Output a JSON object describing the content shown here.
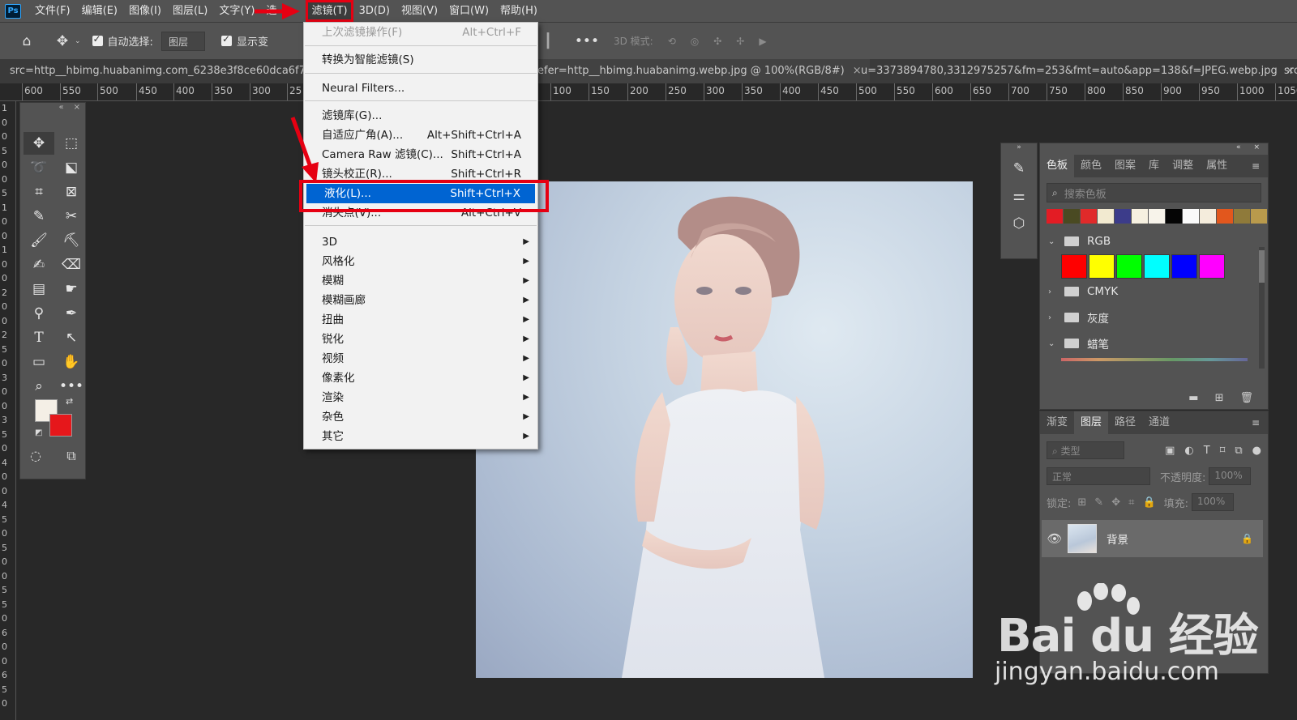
{
  "menubar": {
    "app_icon": "Ps",
    "items": [
      "文件(F)",
      "编辑(E)",
      "图像(I)",
      "图层(L)",
      "文字(Y)",
      "选",
      "滤镜(T)",
      "3D(D)",
      "视图(V)",
      "窗口(W)",
      "帮助(H)"
    ],
    "active_index": 6
  },
  "optionsbar": {
    "auto_select_label": "自动选择:",
    "auto_select_target": "图层",
    "show_transform_label": "显示变",
    "mode_3d_label": "3D 模式:",
    "icons": [
      "home-icon",
      "move-icon",
      "align-icon",
      "more-icon"
    ]
  },
  "tabs": [
    {
      "title": "src=http__hbimg.huabanimg.com_6238e3f8ce60dca6f7f0f"
    },
    {
      "title": "efer=http__hbimg.huabanimg.webp.jpg @ 100%(RGB/8#)"
    },
    {
      "title": "u=3373894780,3312975257&fm=253&fmt=auto&app=138&f=JPEG.webp.jpg"
    },
    {
      "title": "src"
    }
  ],
  "ruler": {
    "top_labels": [
      "600",
      "550",
      "500",
      "450",
      "400",
      "350",
      "300",
      "25",
      "100",
      "150",
      "200",
      "250",
      "300",
      "350",
      "400",
      "450",
      "500",
      "550",
      "600",
      "650",
      "700",
      "750",
      "800",
      "850",
      "900",
      "950",
      "1000",
      "1050"
    ],
    "left_labels": [
      "1",
      "0",
      "0",
      "5",
      "0",
      "0",
      "5",
      "1",
      "0",
      "0",
      "1",
      "0",
      "0",
      "2",
      "0",
      "0",
      "2",
      "5",
      "0",
      "3",
      "0",
      "0",
      "3",
      "5",
      "0",
      "4",
      "0",
      "0",
      "4",
      "5",
      "0",
      "5",
      "0",
      "0",
      "5",
      "5",
      "0",
      "6",
      "0",
      "0",
      "6",
      "5",
      "0"
    ]
  },
  "filter_menu": {
    "items": [
      {
        "label": "上次滤镜操作(F)",
        "shortcut": "Alt+Ctrl+F",
        "disabled": true
      },
      {
        "label": "转换为智能滤镜(S)",
        "shortcut": ""
      },
      {
        "label": "Neural Filters...",
        "shortcut": ""
      },
      {
        "label": "滤镜库(G)...",
        "shortcut": ""
      },
      {
        "label": "自适应广角(A)...",
        "shortcut": "Alt+Shift+Ctrl+A"
      },
      {
        "label": "Camera Raw 滤镜(C)...",
        "shortcut": "Shift+Ctrl+A"
      },
      {
        "label": "镜头校正(R)...",
        "shortcut": "Shift+Ctrl+R"
      },
      {
        "label": "液化(L)...",
        "shortcut": "Shift+Ctrl+X",
        "highlighted": true
      },
      {
        "label": "消失点(V)...",
        "shortcut": "Alt+Ctrl+V"
      },
      {
        "label": "3D",
        "submenu": true
      },
      {
        "label": "风格化",
        "submenu": true
      },
      {
        "label": "模糊",
        "submenu": true
      },
      {
        "label": "模糊画廊",
        "submenu": true
      },
      {
        "label": "扭曲",
        "submenu": true
      },
      {
        "label": "锐化",
        "submenu": true
      },
      {
        "label": "视频",
        "submenu": true
      },
      {
        "label": "像素化",
        "submenu": true
      },
      {
        "label": "渲染",
        "submenu": true
      },
      {
        "label": "杂色",
        "submenu": true
      },
      {
        "label": "其它",
        "submenu": true
      }
    ]
  },
  "swatches_panel": {
    "tabs": [
      "色板",
      "颜色",
      "图案",
      "库",
      "调整",
      "属性"
    ],
    "active_tab": "色板",
    "search_placeholder": "搜索色板",
    "recent_colors": [
      "#e31c24",
      "#4a4a22",
      "#e02a2a",
      "#f2ead0",
      "#3c3c8a",
      "#f6f0e0",
      "#f7f3ea",
      "#050505",
      "#fafafa",
      "#f4ecdc",
      "#e2571d",
      "#8f7a3a",
      "#b99a4c"
    ],
    "groups": [
      {
        "name": "RGB",
        "expanded": true,
        "colors": [
          "#ff0000",
          "#ffff00",
          "#00ff00",
          "#00ffff",
          "#0000ff",
          "#ff00ff"
        ]
      },
      {
        "name": "CMYK",
        "expanded": false
      },
      {
        "name": "灰度",
        "expanded": false
      },
      {
        "name": "蜡笔",
        "expanded": true
      }
    ]
  },
  "layers_panel": {
    "tabs": [
      "渐变",
      "图层",
      "路径",
      "通道"
    ],
    "active_tab": "图层",
    "filter_placeholder": "类型",
    "blend_mode": "正常",
    "opacity_label": "不透明度:",
    "opacity_value": "100%",
    "lock_label": "锁定:",
    "fill_label": "填充:",
    "fill_value": "100%",
    "layers": [
      {
        "name": "背景",
        "visible": true,
        "locked": true
      }
    ]
  },
  "watermark": {
    "brand": "Bai du 经验",
    "url": "jingyan.baidu.com"
  },
  "colors": {
    "foreground": "#f4efe6",
    "background": "#e6171b",
    "highlight": "#0064d2",
    "annotation": "#e60012"
  }
}
